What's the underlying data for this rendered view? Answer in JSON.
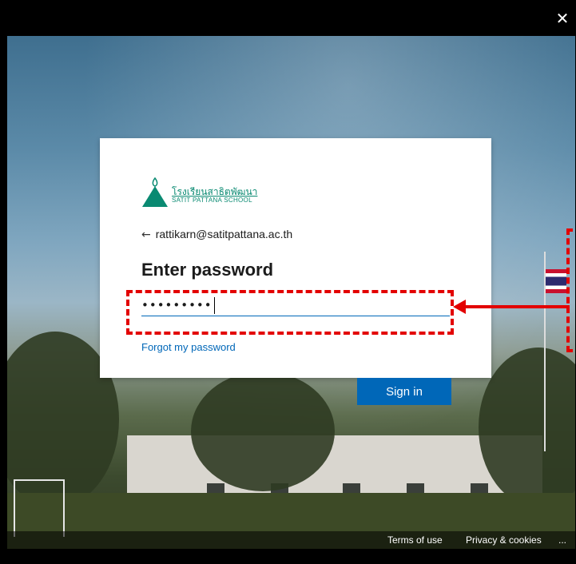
{
  "window": {
    "close_glyph": "✕"
  },
  "logo": {
    "thai_name": "โรงเรียนสาธิตพัฒนา",
    "english_name": "SATIT PATTANA SCHOOL"
  },
  "signin": {
    "back_glyph": "←",
    "account": "rattikarn@satitpattana.ac.th",
    "heading": "Enter password",
    "password_value": "•••••••••",
    "forgot_label": "Forgot my password",
    "submit_label": "Sign in"
  },
  "footer": {
    "terms_label": "Terms of use",
    "privacy_label": "Privacy & cookies",
    "more_label": "..."
  },
  "colors": {
    "accent": "#0067b8",
    "annotation": "#e30000",
    "logo_green": "#0a8a72"
  }
}
